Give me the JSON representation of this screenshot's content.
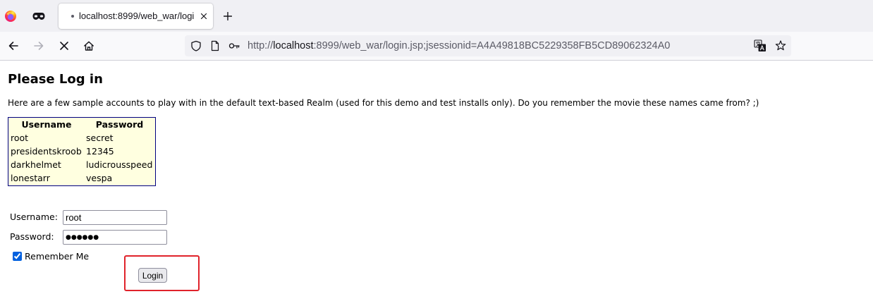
{
  "browser": {
    "tab": {
      "title": "localhost:8999/web_war/logi"
    },
    "address_bar": {
      "scheme": "http://",
      "host": "localhost",
      "path": ":8999/web_war/login.jsp;jsessionid=A4A49818BC5229358FB5CD89062324A0"
    },
    "icons": {
      "firefox_view": "firefox-logo-icon",
      "private_browsing": "mask-icon",
      "tab_indicator": "dot-icon",
      "tab_close": "close-icon",
      "new_tab": "plus-icon",
      "back": "back-arrow-icon",
      "forward": "forward-arrow-icon",
      "stop": "stop-icon",
      "home": "home-icon",
      "tracking_protection": "shield-icon",
      "site_info": "page-icon",
      "permissions": "key-icon",
      "translate": "translate-icon",
      "bookmark": "star-icon"
    }
  },
  "page": {
    "heading": "Please Log in",
    "intro": "Here are a few sample accounts to play with in the default text-based Realm (used for this demo and test installs only). Do you remember the movie these names came from? ;)",
    "accounts": {
      "headers": [
        "Username",
        "Password"
      ],
      "rows": [
        {
          "username": "root",
          "password": "secret"
        },
        {
          "username": "presidentskroob",
          "password": "12345"
        },
        {
          "username": "darkhelmet",
          "password": "ludicrousspeed"
        },
        {
          "username": "lonestarr",
          "password": "vespa"
        }
      ]
    },
    "form": {
      "username_label": "Username:",
      "username_value": "root",
      "password_label": "Password:",
      "password_display": "●●●●●●",
      "remember_label": "Remember Me",
      "remember_checked": true,
      "submit_label": "Login"
    }
  },
  "colors": {
    "accent": "#0060df",
    "table_border": "#000080",
    "table_background": "#ffffe0",
    "highlight": "#e0232b",
    "url_dim": "#5b5b66",
    "url_host": "#15141a"
  }
}
